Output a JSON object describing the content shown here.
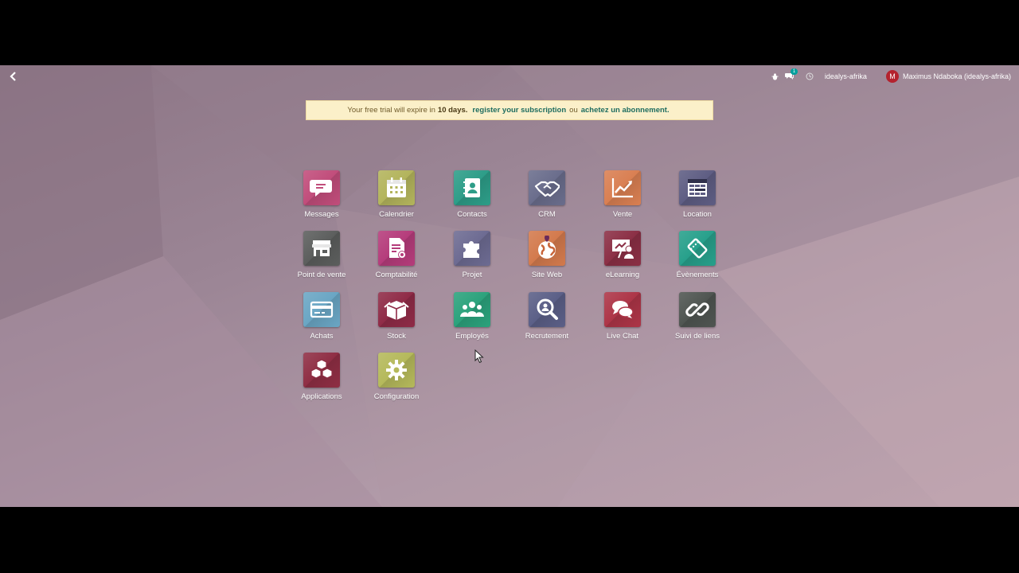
{
  "nav": {
    "company": "idealys-afrika",
    "user_initial": "M",
    "user_name": "Maximus Ndaboka (idealys-afrika)",
    "chat_badge": "1"
  },
  "trial": {
    "prefix": "Your free trial will expire in",
    "days": "10 days.",
    "register": "register your subscription",
    "or": "ou",
    "buy": "achetez un abonnement."
  },
  "apps": [
    {
      "label": "Messages",
      "icon": "chat-bubble-icon",
      "color": "#c14d7b"
    },
    {
      "label": "Calendrier",
      "icon": "calendar-icon",
      "color": "#b3b45c"
    },
    {
      "label": "Contacts",
      "icon": "address-book-icon",
      "color": "#2d9d88"
    },
    {
      "label": "CRM",
      "icon": "handshake-icon",
      "color": "#6a6d8c"
    },
    {
      "label": "Vente",
      "icon": "line-chart-icon",
      "color": "#d97f52"
    },
    {
      "label": "Location",
      "icon": "calendar-grid-icon",
      "color": "#5e5d83"
    },
    {
      "label": "Point de vente",
      "icon": "shop-icon",
      "color": "#5c5e5d"
    },
    {
      "label": "Comptabilité",
      "icon": "document-gear-icon",
      "color": "#b53c7b"
    },
    {
      "label": "Projet",
      "icon": "puzzle-icon",
      "color": "#6d6b92"
    },
    {
      "label": "Site Web",
      "icon": "globe-icon",
      "color": "#d37a4d"
    },
    {
      "label": "eLearning",
      "icon": "presentation-icon",
      "color": "#8b2f45"
    },
    {
      "label": "Évènements",
      "icon": "ticket-icon",
      "color": "#27a08b"
    },
    {
      "label": "Achats",
      "icon": "credit-card-icon",
      "color": "#6aa6c4"
    },
    {
      "label": "Stock",
      "icon": "box-icon",
      "color": "#8f2b47"
    },
    {
      "label": "Employés",
      "icon": "users-icon",
      "color": "#2ba27c"
    },
    {
      "label": "Recrutement",
      "icon": "magnifier-icon",
      "color": "#5b5f87"
    },
    {
      "label": "Live Chat",
      "icon": "chat-bubbles-icon",
      "color": "#ad3547"
    },
    {
      "label": "Suivi de liens",
      "icon": "link-icon",
      "color": "#4f5551"
    },
    {
      "label": "Applications",
      "icon": "cubes-icon",
      "color": "#8f2e44"
    },
    {
      "label": "Configuration",
      "icon": "gear-icon",
      "color": "#b5b95b"
    }
  ]
}
